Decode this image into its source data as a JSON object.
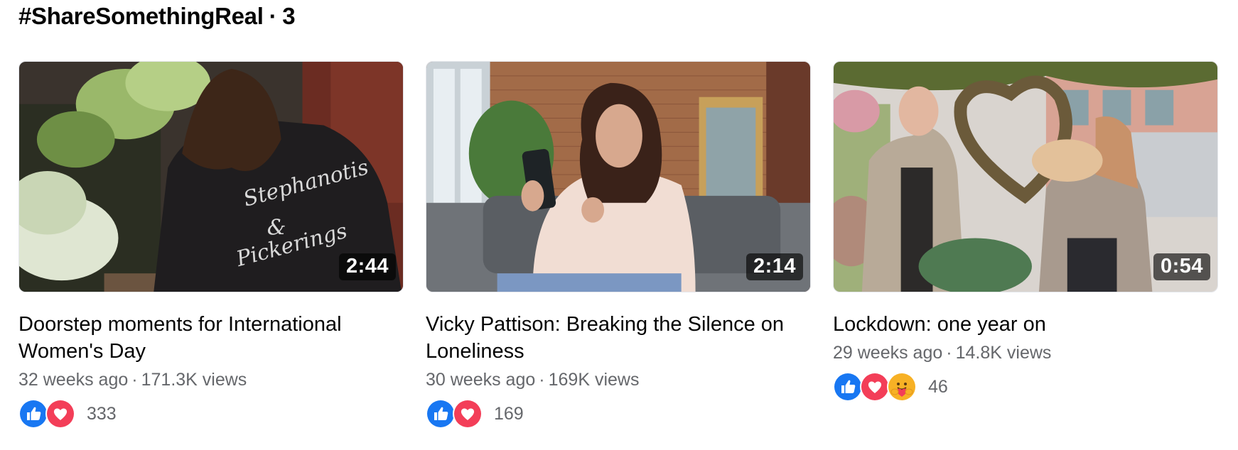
{
  "header": {
    "tag": "#ShareSomethingReal",
    "separator": "·",
    "count": "3"
  },
  "videos": [
    {
      "duration": "2:44",
      "title": "Doorstep moments for International Women's Day",
      "age": "32 weeks ago",
      "views": "171.3K views",
      "reactions": [
        "like",
        "love"
      ],
      "reaction_count": "333"
    },
    {
      "duration": "2:14",
      "title": "Vicky Pattison: Breaking the Silence on Loneliness",
      "age": "30 weeks ago",
      "views": "169K views",
      "reactions": [
        "like",
        "love"
      ],
      "reaction_count": "169"
    },
    {
      "duration": "0:54",
      "title": "Lockdown: one year on",
      "age": "29 weeks ago",
      "views": "14.8K views",
      "reactions": [
        "like",
        "love",
        "care"
      ],
      "reaction_count": "46"
    }
  ],
  "meta_separator": "·",
  "colors": {
    "like": "#1877f2",
    "love": "#f33e58",
    "care": "#f7b125",
    "secondary_text": "#65676b"
  }
}
